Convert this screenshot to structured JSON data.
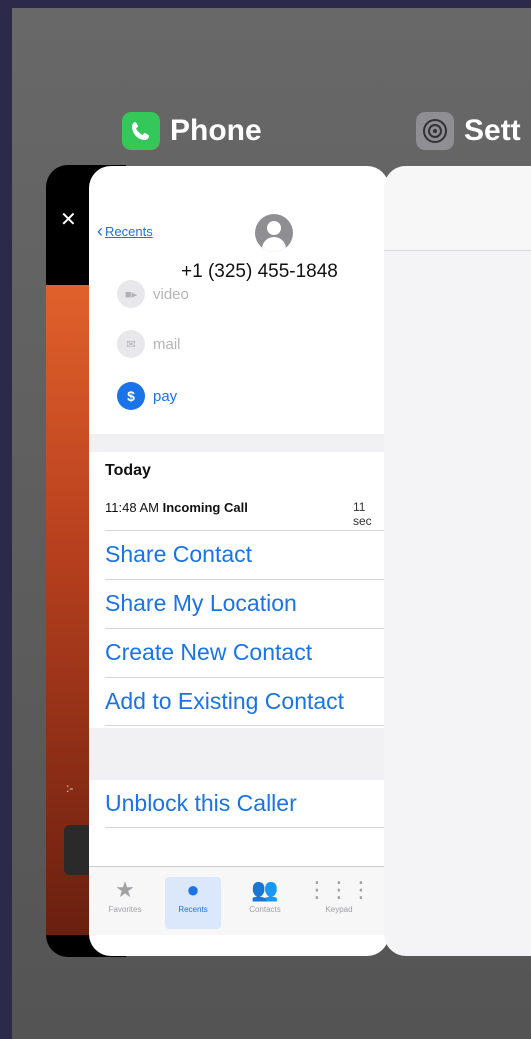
{
  "switcher": {
    "apps": [
      {
        "name": "Phone",
        "icon": "phone-icon"
      },
      {
        "name": "Sett",
        "icon": "settings-icon"
      }
    ]
  },
  "phone": {
    "back_label": "Recents",
    "number": "+1 (325) 455-1848",
    "actions": [
      {
        "label": "video",
        "icon": "video-icon",
        "state": "disabled"
      },
      {
        "label": "mail",
        "icon": "mail-icon",
        "state": "disabled"
      },
      {
        "label": "pay",
        "icon": "dollar-icon",
        "state": "enabled"
      }
    ],
    "history": {
      "section": "Today",
      "time": "11:48 AM",
      "type": "Incoming Call",
      "duration": "11 sec"
    },
    "options": [
      "Share Contact",
      "Share My Location",
      "Create New Contact",
      "Add to Existing Contact"
    ],
    "block_option": "Unblock this Caller",
    "tabs": [
      {
        "label": "Favorites",
        "icon": "star-icon"
      },
      {
        "label": "Recents",
        "icon": "clock-icon",
        "active": true
      },
      {
        "label": "Contacts",
        "icon": "contacts-icon"
      },
      {
        "label": "Keypad",
        "icon": "keypad-icon"
      }
    ]
  },
  "colors": {
    "accent": "#1a73e8",
    "phone_icon": "#34c759"
  }
}
